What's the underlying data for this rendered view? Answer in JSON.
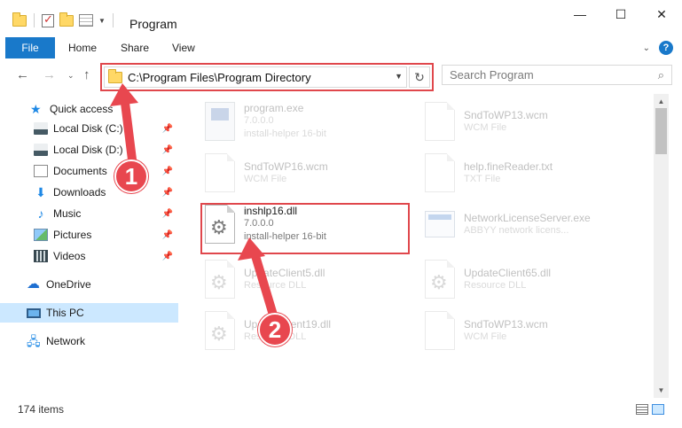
{
  "window": {
    "title": "Program",
    "buttons": {
      "minimize": "—",
      "maximize": "☐",
      "close": "✕"
    }
  },
  "ribbon": {
    "tabs": [
      "File",
      "Home",
      "Share",
      "View"
    ],
    "help": "?"
  },
  "address": {
    "path": "C:\\Program Files\\Program Directory",
    "search_placeholder": "Search Program"
  },
  "sidebar": {
    "items": [
      {
        "label": "Quick access",
        "icon": "star-icon"
      },
      {
        "label": "Local Disk (C:)",
        "icon": "drive-icon",
        "pinned": true
      },
      {
        "label": "Local Disk (D:)",
        "icon": "drive-icon",
        "pinned": true
      },
      {
        "label": "Documents",
        "icon": "documents-icon",
        "pinned": true
      },
      {
        "label": "Downloads",
        "icon": "downloads-icon",
        "pinned": true
      },
      {
        "label": "Music",
        "icon": "music-icon",
        "pinned": true
      },
      {
        "label": "Pictures",
        "icon": "pictures-icon",
        "pinned": true
      },
      {
        "label": "Videos",
        "icon": "videos-icon",
        "pinned": true
      },
      {
        "label": "OneDrive",
        "icon": "onedrive-icon"
      },
      {
        "label": "This PC",
        "icon": "this-pc-icon",
        "selected": true
      },
      {
        "label": "Network",
        "icon": "network-icon"
      }
    ]
  },
  "files": [
    {
      "name": "program.exe",
      "line2": "7.0.0.0",
      "line3": "install-helper 16-bit",
      "icon": "exe-icon"
    },
    {
      "name": "SndToWP13.wcm",
      "line2": "WCM File",
      "icon": "document-icon"
    },
    {
      "name": "SndToWP16.wcm",
      "line2": "WCM File",
      "icon": "document-icon"
    },
    {
      "name": "help.fineReader.txt",
      "line2": "TXT File",
      "icon": "document-icon"
    },
    {
      "name": "inshlp16.dll",
      "line2": "7.0.0.0",
      "line3": "install-helper 16-bit",
      "icon": "dll-gear-icon"
    },
    {
      "name": "NetworkLicenseServer.exe",
      "line2": "ABBYY network licens...",
      "icon": "exe-icon"
    },
    {
      "name": "UpdateClient5.dll",
      "line2": "Resource DLL",
      "icon": "dll-gear-icon"
    },
    {
      "name": "UpdateClient65.dll",
      "line2": "Resource DLL",
      "icon": "dll-gear-icon"
    },
    {
      "name": "UpdateClient19.dll",
      "line2": "Resource DLL",
      "icon": "dll-gear-icon"
    },
    {
      "name": "SndToWP13.wcm",
      "line2": "WCM File",
      "icon": "document-icon"
    }
  ],
  "status": {
    "item_count": "174 items"
  },
  "annotations": {
    "step1": "1",
    "step2": "2",
    "color": "#e8474f"
  }
}
